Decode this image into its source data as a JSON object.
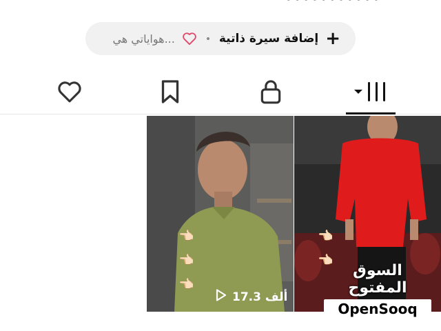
{
  "bio": {
    "add_bio_label": "إضافة سيرة ذاتية",
    "hobbies_text": "هواياتي هي..."
  },
  "tabs": [
    {
      "name": "videos",
      "icon": "grid-icon",
      "active": true
    },
    {
      "name": "private",
      "icon": "lock-icon",
      "active": false
    },
    {
      "name": "saved",
      "icon": "bookmark-icon",
      "active": false
    },
    {
      "name": "liked",
      "icon": "heart-icon",
      "active": false
    }
  ],
  "videos": [
    {
      "views": "17.3 ألف"
    },
    {
      "views": ""
    }
  ],
  "watermark": {
    "arabic": "السوق المفتوح",
    "english": "OpenSooq"
  },
  "colors": {
    "pill_bg": "#f1f1f1",
    "heart_outline": "#e0476a",
    "shirt_green": "#8f9a52",
    "shirt_red": "#e01b1b"
  }
}
